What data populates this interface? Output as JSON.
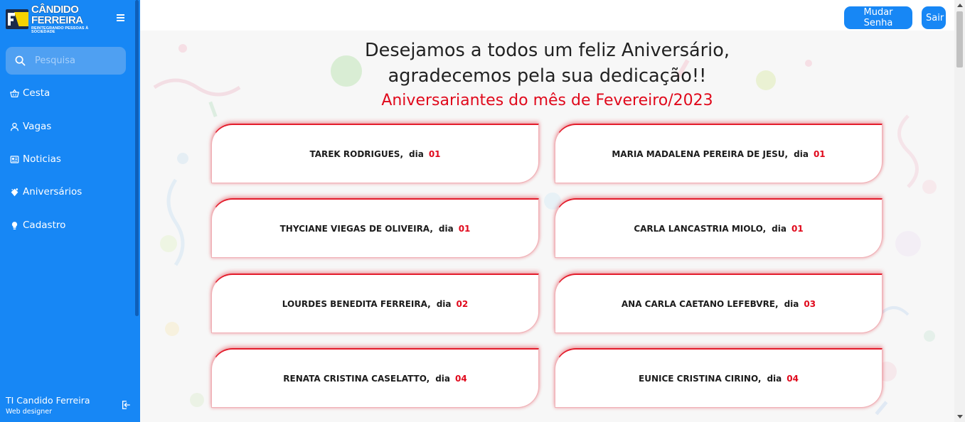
{
  "sidebar": {
    "brand_title": "CÂNDIDO FERREIRA",
    "brand_subtitle": "REINTEGRANDO PESSOAS À SOCIEDADE",
    "search_placeholder": "Pesquisa",
    "items": [
      {
        "label": "Cesta",
        "icon": "basket-icon"
      },
      {
        "label": "Vagas",
        "icon": "user-icon"
      },
      {
        "label": "Noticias",
        "icon": "newspaper-icon"
      },
      {
        "label": "Aniversários",
        "icon": "cake-icon"
      },
      {
        "label": "Cadastro",
        "icon": "lightbulb-icon"
      }
    ],
    "user_name": "TI Candido Ferreira",
    "user_role": "Web designer"
  },
  "topbar": {
    "change_password_label": "Mudar Senha",
    "logout_label": "Sair"
  },
  "main": {
    "heading_line1": "Desejamos a todos um feliz Aniversário,",
    "heading_line2": "agradecemos pela sua dedicação!!",
    "subheading": "Aniversariantes do mês de Fevereiro/2023",
    "dia_label": "dia",
    "birthdays": [
      {
        "name": "TAREK RODRIGUES,",
        "day": "01"
      },
      {
        "name": "MARIA MADALENA PEREIRA DE JESU,",
        "day": "01"
      },
      {
        "name": "THYCIANE VIEGAS DE OLIVEIRA,",
        "day": "01"
      },
      {
        "name": "CARLA LANCASTRIA MIOLO,",
        "day": "01"
      },
      {
        "name": "LOURDES BENEDITA FERREIRA,",
        "day": "02"
      },
      {
        "name": "ANA CARLA CAETANO LEFEBVRE,",
        "day": "03"
      },
      {
        "name": "RENATA CRISTINA CASELATTO,",
        "day": "04"
      },
      {
        "name": "EUNICE CRISTINA CIRINO,",
        "day": "04"
      }
    ]
  },
  "colors": {
    "sidebar_blue": "#1787f5",
    "accent_red": "#e0091c"
  }
}
